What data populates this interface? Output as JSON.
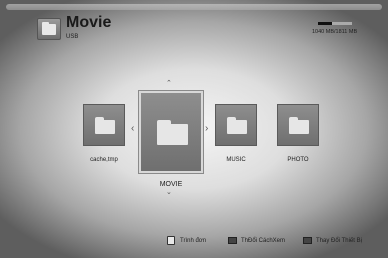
{
  "header": {
    "title": "Movie",
    "subtitle": "USB",
    "storage": "1040 MB/1811 MB"
  },
  "folders": [
    {
      "name": "cache,tmp",
      "selected": false
    },
    {
      "name": "MOVIE",
      "selected": true
    },
    {
      "name": "MUSIC",
      "selected": false
    },
    {
      "name": "PHOTO",
      "selected": false
    }
  ],
  "arrows": {
    "up": "⌃",
    "down": "⌄",
    "left": "‹",
    "right": "›"
  },
  "footer": {
    "menu": "Trình đơn",
    "change_view": "ThĐổi CáchXem",
    "change_device": "Thay Đổi Thiết Bị"
  }
}
